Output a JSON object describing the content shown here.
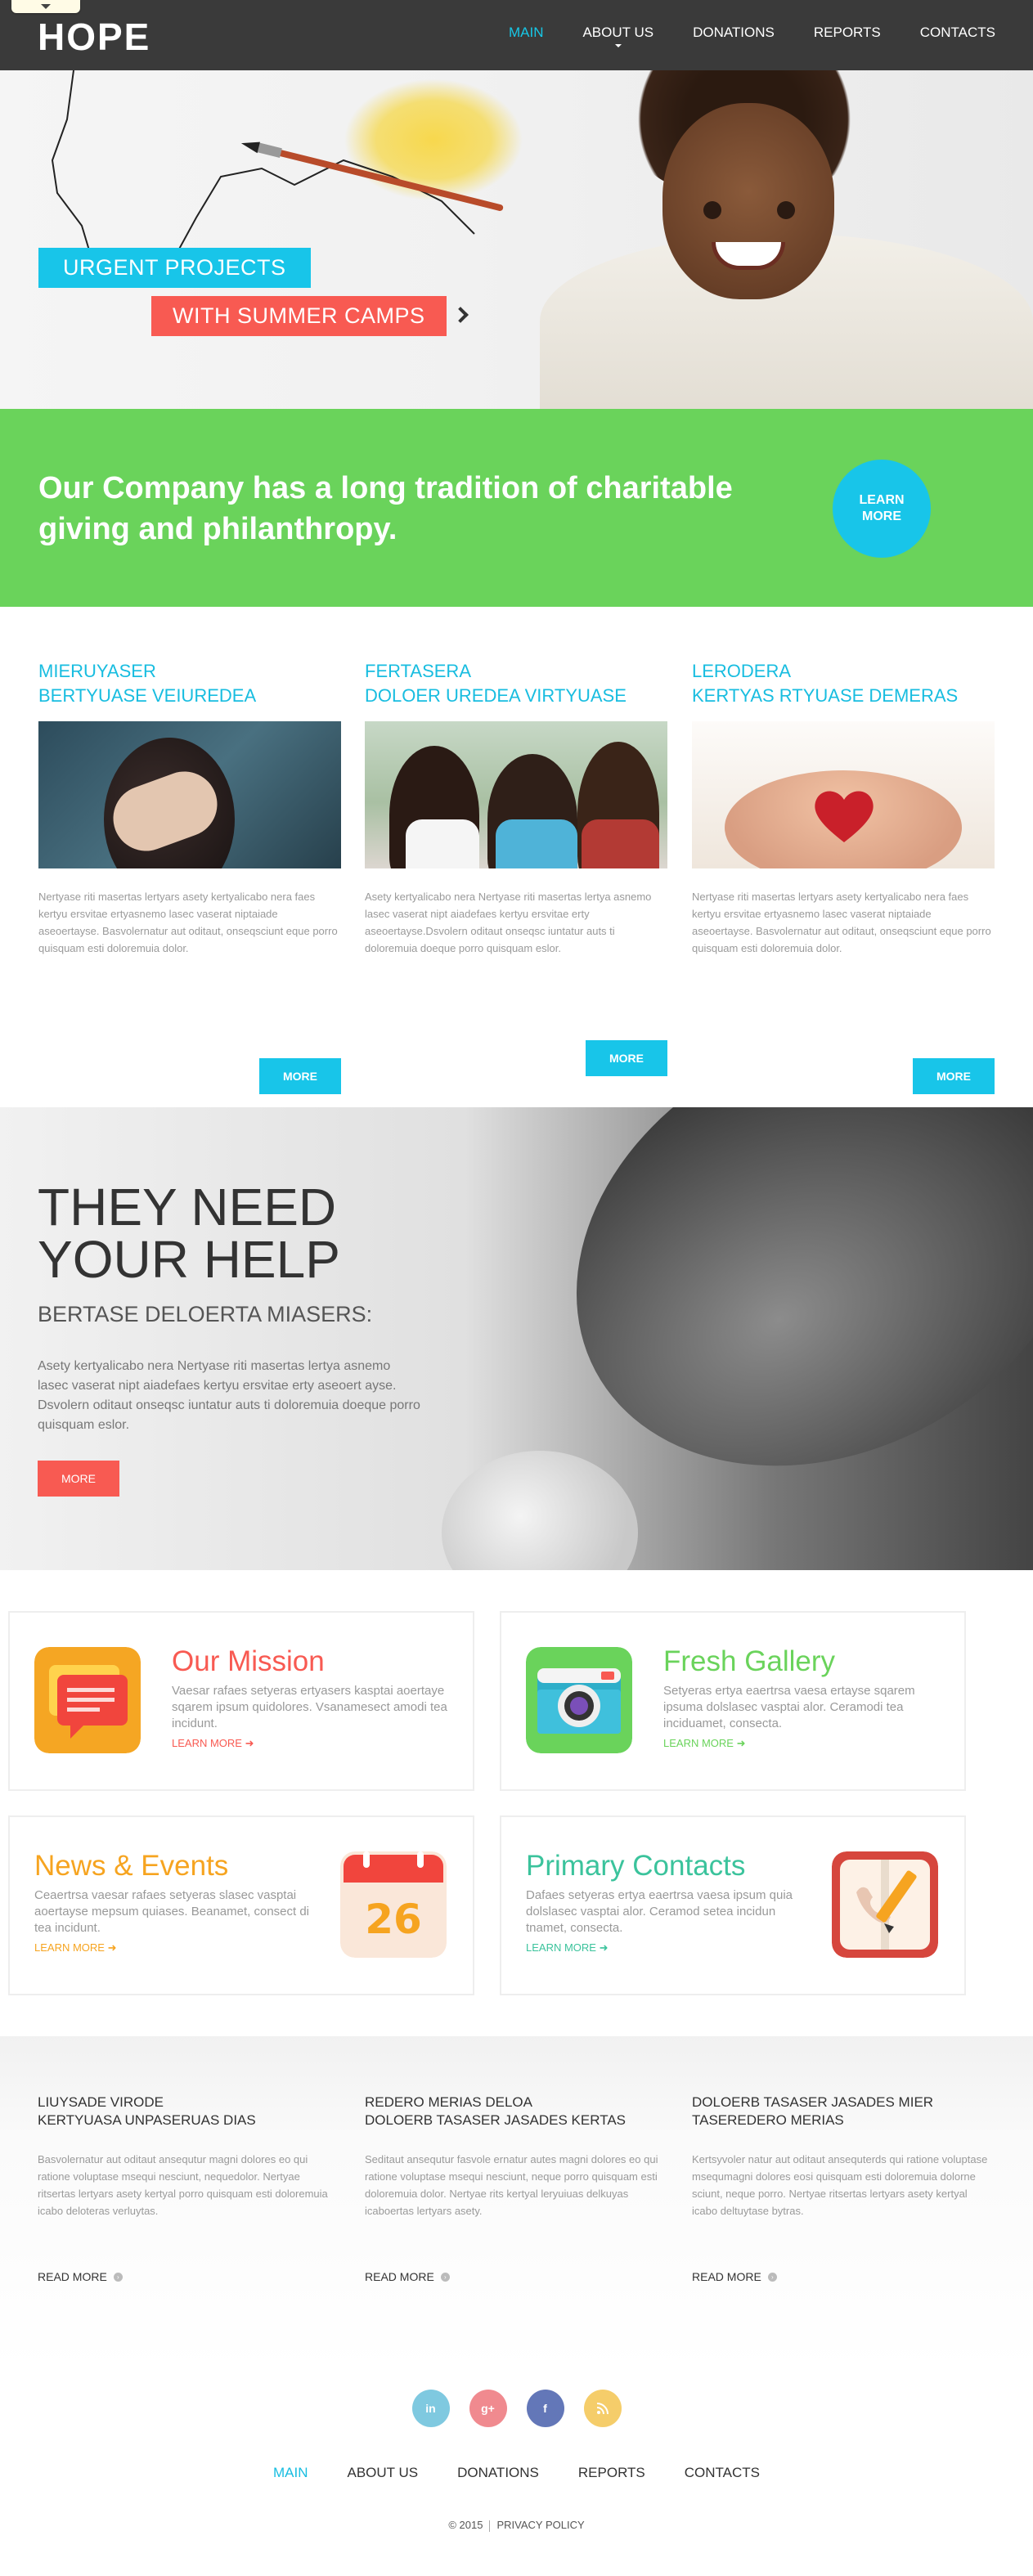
{
  "header": {
    "logo": "HOPE",
    "nav": [
      "MAIN",
      "ABOUT US",
      "DONATIONS",
      "REPORTS",
      "CONTACTS"
    ]
  },
  "hero": {
    "line1": "URGENT PROJECTS",
    "line2": "WITH SUMMER CAMPS",
    "slides": 3,
    "active_slide": 2
  },
  "band": {
    "text": "Our Company has a long tradition of charitable giving and philanthropy.",
    "button_line1": "LEARN",
    "button_line2": "MORE"
  },
  "features": [
    {
      "title1": "MIERUYASER",
      "title2": "BERTYUASE VEIUREDEA",
      "text": "Nertyase riti masertas lertyars asety kertyalicabo nera faes kertyu ersvitae ertyasnemo lasec vaserat niptaiade aseoertayse. Basvolernatur aut oditaut, onseqsciunt eque porro quisquam esti doloremuia dolor.",
      "button": "MORE"
    },
    {
      "title1": "FERTASERA",
      "title2": "DOLOER UREDEA VIRTYUASE",
      "text": "Asety kertyalicabo nera Nertyase riti masertas lertya asnemo lasec vaserat nipt aiadefaes kertyu ersvitae erty aseoertayse.Dsvolern oditaut onseqsc iuntatur auts ti doloremuia doeque porro quisquam eslor.",
      "button": "MORE"
    },
    {
      "title1": "LERODERA",
      "title2": "KERTYAS RTYUASE DEMERAS",
      "text": "Nertyase riti masertas lertyars asety kertyalicabo nera faes kertyu ersvitae ertyasnemo lasec vaserat niptaiade aseoertayse. Basvolernatur aut oditaut, onseqsciunt eque porro quisquam esti doloremuia dolor.",
      "button": "MORE"
    }
  ],
  "help": {
    "title1": "THEY NEED",
    "title2": "YOUR HELP",
    "subtitle": "BERTASE DELOERTA MIASERS:",
    "text": "Asety kertyalicabo nera Nertyase riti masertas lertya asnemo lasec vaserat nipt aiadefaes kertyu ersvitae erty aseoert ayse. Dsvolern oditaut onseqsc iuntatur auts ti doloremuia doeque porro quisquam eslor.",
    "button": "MORE"
  },
  "services": [
    {
      "title": "Our Mission",
      "text": "Vaesar rafaes setyeras ertyasers kasptai aoertaye sqarem ipsum quidolores. Vsanamesect amodi tea incidunt.",
      "link": "LEARN MORE",
      "icon": "chat-icon",
      "color": "#f85a52"
    },
    {
      "title": "Fresh Gallery",
      "text": "Setyeras ertya eaertrsa vaesa ertayse sqarem ipsuma dolslasec vasptai alor. Ceramodi tea inciduamet, consecta.",
      "link": "LEARN MORE",
      "icon": "camera-icon",
      "color": "#6ad35b"
    },
    {
      "title": "News & Events",
      "text": "Ceaertrsa vaesar rafaes setyeras slasec vasptai aoertayse mepsum quiases. Beanamet, consect di tea incidunt.",
      "link": "LEARN MORE",
      "icon": "calendar-icon",
      "calendar_day": "26",
      "color": "#f6a420"
    },
    {
      "title": "Primary Contacts",
      "text": "Dafaes setyeras ertya eaertrsa vaesa ipsum quia dolslasec vasptai alor. Ceramod setea incidun tnamet, consecta.",
      "link": "LEARN MORE",
      "icon": "contacts-icon",
      "color": "#3bc39c"
    }
  ],
  "blog": [
    {
      "title1": "LIUYSADE VIRODE",
      "title2": "KERTYUASA UNPASERUAS DIAS",
      "text": "Basvolernatur aut oditaut ansequtur magni dolores eo qui ratione voluptase msequi nesciunt, nequedolor. Nertyae ritsertas lertyars asety kertyal porro quisquam esti doloremuia icabo deloteras verluytas.",
      "link": "READ MORE"
    },
    {
      "title1": "REDERO MERIAS DELOA",
      "title2": "DOLOERB TASASER JASADES KERTAS",
      "text": "Seditaut ansequtur fasvole ernatur autes magni dolores eo qui ratione voluptase msequi nesciunt, neque porro quisquam esti doloremuia dolor. Nertyae rits kertyal leryuiuas delkuyas icaboertas lertyars asety.",
      "link": "READ MORE"
    },
    {
      "title1": "DOLOERB TASASER JASADES MIER",
      "title2": "TASEREDERO MERIAS",
      "text": "Kertsyvoler natur aut oditaut ansequterds qui ratione voluptase msequmagni dolores eosi quisquam esti doloremuia dolorne sciunt, neque porro. Nertyae ritsertas lertyars asety kertyal icabo deltuytase bytras.",
      "link": "READ MORE"
    }
  ],
  "footer": {
    "social": [
      "in",
      "g+",
      "f",
      "rss"
    ],
    "nav": [
      "MAIN",
      "ABOUT US",
      "DONATIONS",
      "REPORTS",
      "CONTACTS"
    ],
    "copyright": "© 2015",
    "privacy": "PRIVACY POLICY"
  },
  "colors": {
    "accent_blue": "#18c5e9",
    "accent_red": "#f85a52",
    "accent_green": "#6ad35b",
    "header_bg": "#3a3a3a"
  }
}
